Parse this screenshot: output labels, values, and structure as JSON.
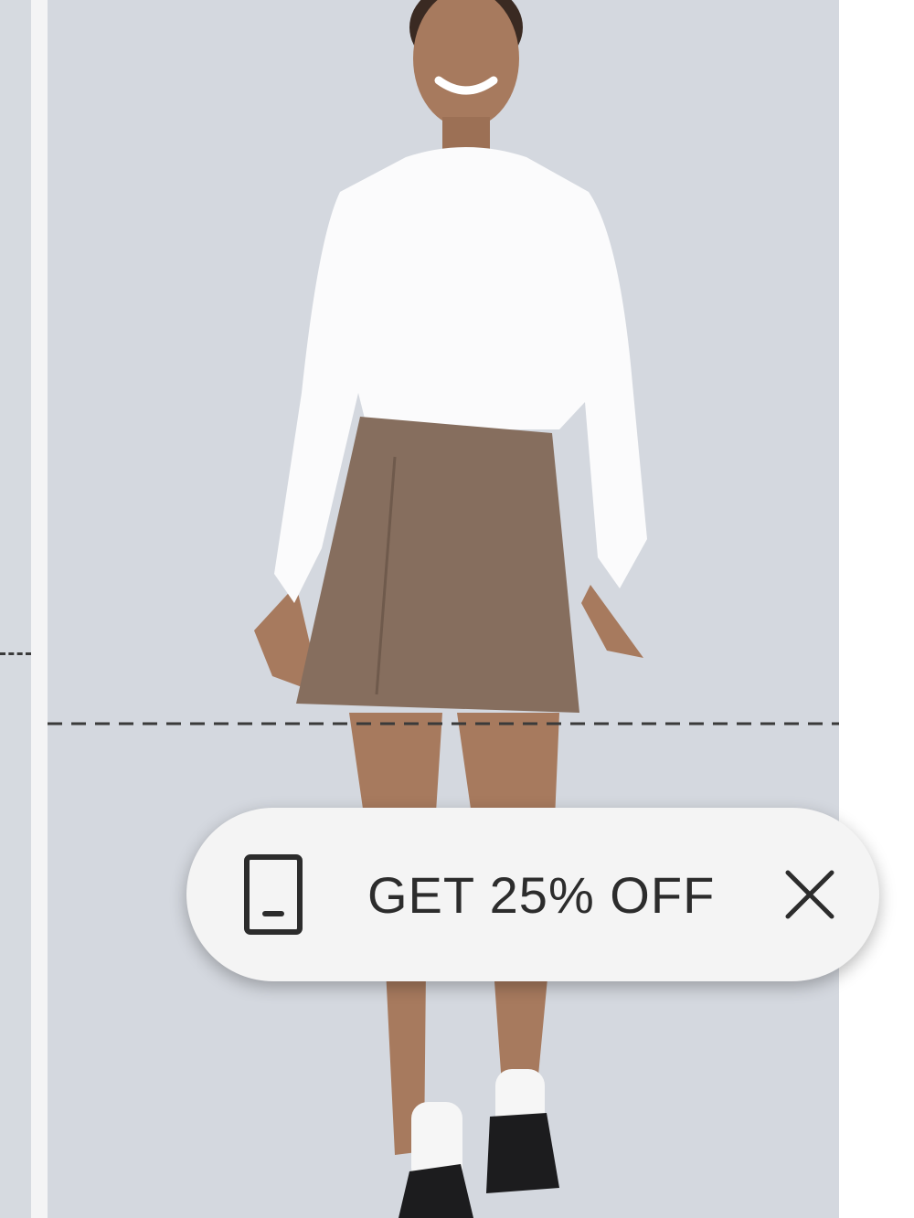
{
  "promo": {
    "label": "GET 25% OFF",
    "icon": "mobile-phone-icon",
    "close_icon": "close-icon"
  },
  "product_image": {
    "background": "#d4d8df",
    "top_color": "#ffffff",
    "skirt_color": "#866e5e",
    "skin_color": "#a77a5e"
  }
}
